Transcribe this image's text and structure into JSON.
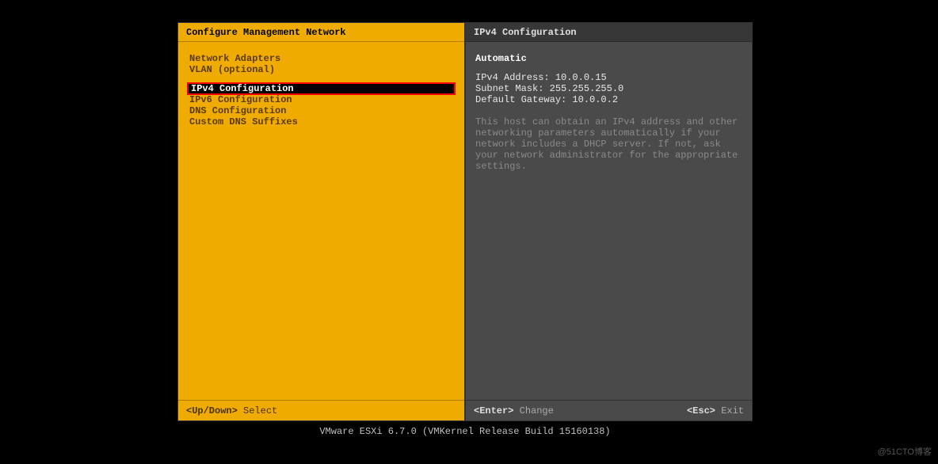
{
  "left": {
    "title": "Configure Management Network",
    "group1": [
      {
        "label": "Network Adapters"
      },
      {
        "label": "VLAN (optional)"
      }
    ],
    "group2": [
      {
        "label": "IPv4 Configuration",
        "selected": true
      },
      {
        "label": "IPv6 Configuration"
      },
      {
        "label": "DNS Configuration"
      },
      {
        "label": "Custom DNS Suffixes"
      }
    ],
    "footer_key": "<Up/Down>",
    "footer_action": "Select"
  },
  "right": {
    "title": "IPv4 Configuration",
    "mode": "Automatic",
    "lines": {
      "ipv4_label": "IPv4 Address:",
      "ipv4_value": "10.0.0.15",
      "mask_label": "Subnet Mask:",
      "mask_value": "255.255.255.0",
      "gw_label": "Default Gateway:",
      "gw_value": "10.0.0.2"
    },
    "description": "This host can obtain an IPv4 address and other networking parameters automatically if your network includes a DHCP server. If not, ask your network administrator for the appropriate settings.",
    "footer_enter_key": "<Enter>",
    "footer_enter_action": "Change",
    "footer_esc_key": "<Esc>",
    "footer_esc_action": "Exit"
  },
  "bottom_bar": "VMware ESXi 6.7.0 (VMKernel Release Build 15160138)",
  "watermark": "@51CTO博客"
}
